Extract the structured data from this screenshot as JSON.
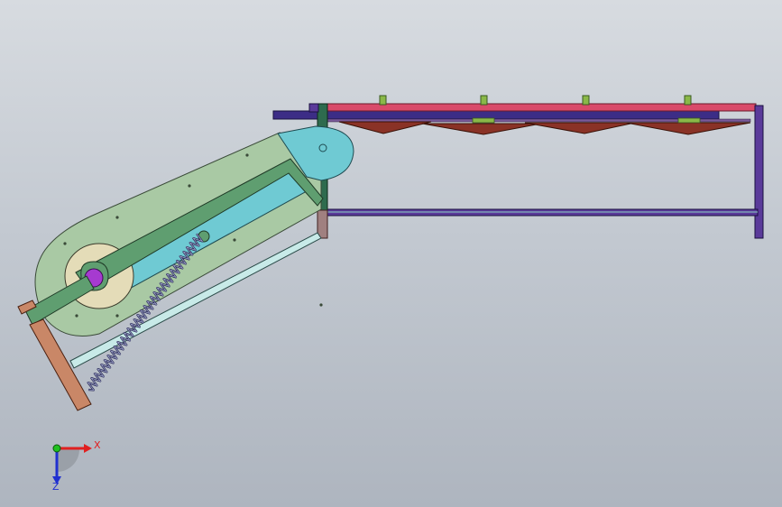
{
  "viewport": {
    "background_top": "#d7dbe0",
    "background_bottom": "#aeb5bf"
  },
  "triad": {
    "x_label": "X",
    "z_label": "Z",
    "x_color": "#e02020",
    "z_color": "#2030d0",
    "y_color": "#20c020"
  },
  "colors": {
    "arm_plate": "#a9c9a4",
    "arm_accent": "#6fcad3",
    "link_bar": "#5f9e70",
    "pivot_hub": "#a63ad0",
    "hub_ring": "#e4dcb8",
    "spring": "#2a2a55",
    "rod": "#c8eae8",
    "handle": "#c98767",
    "frame_red": "#d94a6a",
    "frame_blue": "#3c2d86",
    "frame_purple": "#5a3a9a",
    "cutter": "#8a3226",
    "post": "#8ab848",
    "upright_green": "#2e6b4e",
    "upright_tan": "#a08080"
  }
}
